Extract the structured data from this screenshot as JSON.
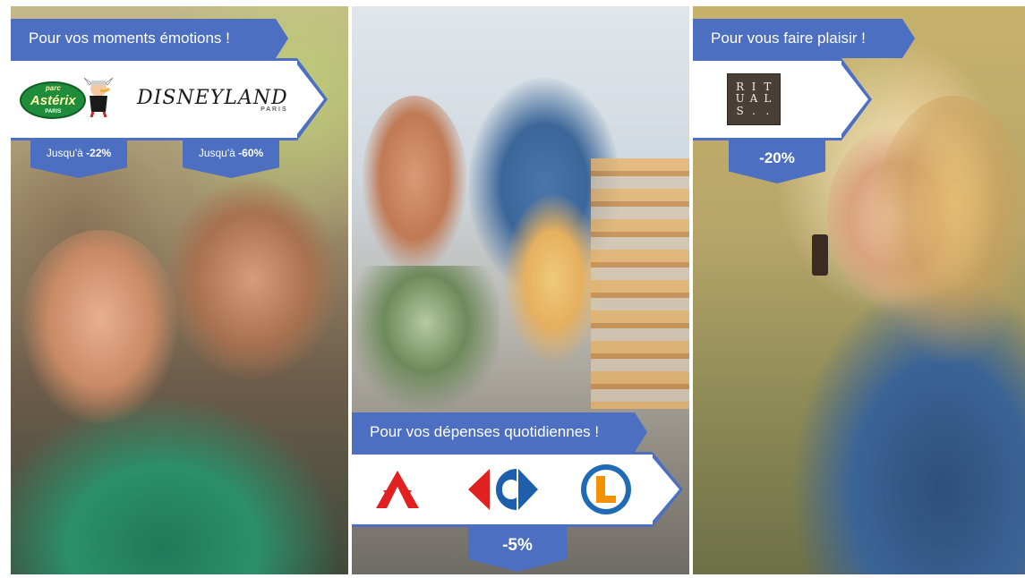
{
  "left_panel": {
    "banner": "Pour vos moments émotions !",
    "logos": {
      "asterix": {
        "top": "parc",
        "name": "Astérix",
        "bottom": "PARIS"
      },
      "disney": {
        "name": "DISNEYLAND",
        "sub": "PARIS"
      }
    },
    "discounts": [
      {
        "prefix": "Jusqu'à ",
        "value": "-22%"
      },
      {
        "prefix": "Jusqu'à ",
        "value": "-60%"
      }
    ]
  },
  "middle_panel": {
    "banner": "Pour vos dépenses quotidiennes !",
    "logos": [
      "auchan-icon",
      "carrefour-icon",
      "leclerc-icon"
    ],
    "discount": "-5%"
  },
  "right_panel": {
    "banner": "Pour vous faire plaisir !",
    "logo": {
      "letters": [
        "R",
        "I",
        "T",
        "U",
        "A",
        "L",
        "S",
        ".",
        "."
      ]
    },
    "discount": "-20%"
  },
  "colors": {
    "accent": "#4c6fc1",
    "auchan_red": "#e1211f",
    "carrefour_blue": "#1d5faa",
    "carrefour_red": "#e1211f",
    "leclerc_blue": "#1f6cb4",
    "leclerc_orange": "#f39200"
  }
}
